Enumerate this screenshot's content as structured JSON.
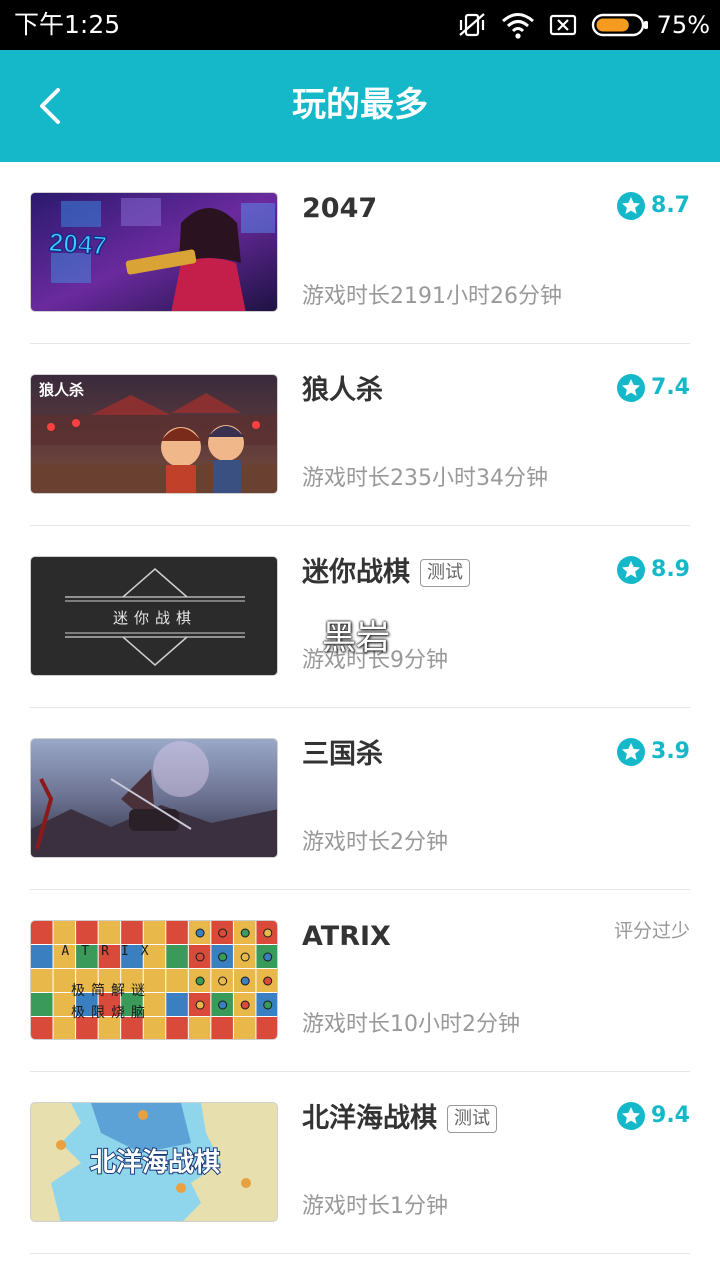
{
  "status_bar": {
    "time": "下午1:25",
    "battery_percent": "75%",
    "battery_level": 0.75,
    "icons": [
      "vibrate-off-icon",
      "wifi-icon",
      "sim-blocked-icon",
      "battery-icon"
    ]
  },
  "header": {
    "title": "玩的最多",
    "back_icon": "chevron-left-icon"
  },
  "colors": {
    "accent": "#15b8c9",
    "status_bar_bg": "#000000",
    "battery_fill": "#f59b1f",
    "secondary_text": "#999999"
  },
  "games": [
    {
      "name": "2047",
      "tag": "",
      "play_time": "游戏时长2191小时26分钟",
      "rating": "8.7",
      "rating_note": ""
    },
    {
      "name": "狼人杀",
      "tag": "",
      "play_time": "游戏时长235小时34分钟",
      "rating": "7.4",
      "rating_note": ""
    },
    {
      "name": "迷你战棋",
      "tag": "测试",
      "play_time": "游戏时长9分钟",
      "rating": "8.9",
      "rating_note": ""
    },
    {
      "name": "三国杀",
      "tag": "",
      "play_time": "游戏时长2分钟",
      "rating": "3.9",
      "rating_note": ""
    },
    {
      "name": "ATRIX",
      "tag": "",
      "play_time": "游戏时长10小时2分钟",
      "rating": "",
      "rating_note": "评分过少"
    },
    {
      "name": "北洋海战棋",
      "tag": "测试",
      "play_time": "游戏时长1分钟",
      "rating": "9.4",
      "rating_note": ""
    }
  ],
  "thumbnail_texts": {
    "game1_logo": "2047",
    "game2_logo": "狼人杀",
    "game3_logo": "迷你战棋",
    "game5_title": "ATRIX",
    "game5_line1": "极简解谜",
    "game5_line2": "极限烧脑",
    "game6_logo": "北洋海战棋"
  },
  "watermark": "黑岩"
}
